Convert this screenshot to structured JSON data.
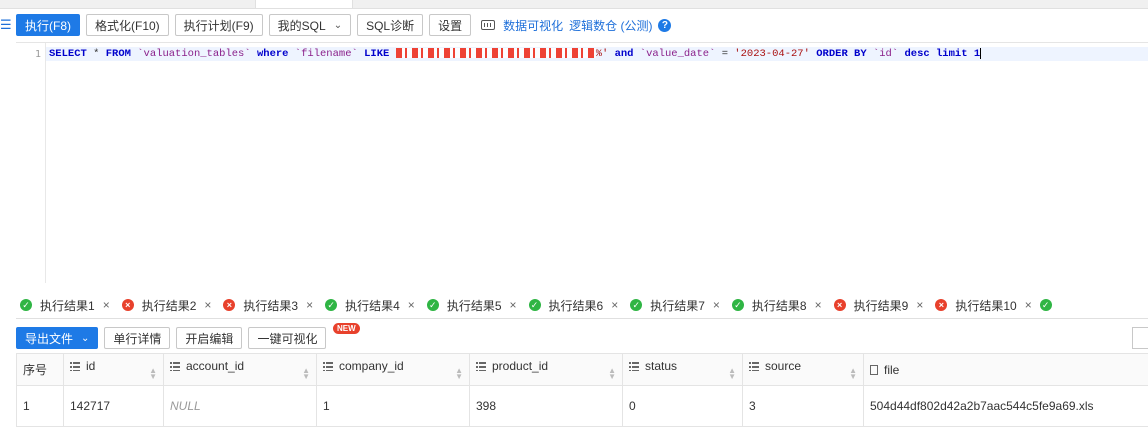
{
  "toolbar": {
    "execute": "执行(F8)",
    "format": "格式化(F10)",
    "plan": "执行计划(F9)",
    "my_sql": "我的SQL",
    "diagnose": "SQL诊断",
    "settings": "设置",
    "visualize": "数据可视化",
    "logic_set": "逻辑数仓 (公测)"
  },
  "editor": {
    "line_number": "1",
    "sql": {
      "select": "SELECT",
      "star": " * ",
      "from": "FROM",
      "table": " `valuation_tables` ",
      "where": "where",
      "col1": " `filename` ",
      "like": "LIKE",
      "like_value_tail": "%'",
      "and": "and",
      "col2": "  `value_date` ",
      "eq": "= ",
      "date_value": "'2023-04-27'",
      "order": "ORDER BY",
      "order_col": " `id` ",
      "desc": "desc",
      "limit": "limit",
      "limit_val": " 1"
    }
  },
  "result_tabs": [
    {
      "label": "执行结果1",
      "status": "ok"
    },
    {
      "label": "执行结果2",
      "status": "err"
    },
    {
      "label": "执行结果3",
      "status": "err"
    },
    {
      "label": "执行结果4",
      "status": "ok"
    },
    {
      "label": "执行结果5",
      "status": "ok"
    },
    {
      "label": "执行结果6",
      "status": "ok"
    },
    {
      "label": "执行结果7",
      "status": "ok"
    },
    {
      "label": "执行结果8",
      "status": "ok"
    },
    {
      "label": "执行结果9",
      "status": "err"
    },
    {
      "label": "执行结果10",
      "status": "err"
    }
  ],
  "result_toolbar": {
    "export": "导出文件",
    "row_detail": "单行详情",
    "edit": "开启编辑",
    "visualize": "一键可视化",
    "new_badge": "NEW"
  },
  "table": {
    "headers": [
      "序号",
      "id",
      "account_id",
      "company_id",
      "product_id",
      "status",
      "source",
      "file"
    ],
    "rows": [
      [
        "1",
        "142717",
        "NULL",
        "1",
        "398",
        "0",
        "3",
        "504d44df802d42a2b7aac544c5fe9a69.xls"
      ]
    ]
  }
}
